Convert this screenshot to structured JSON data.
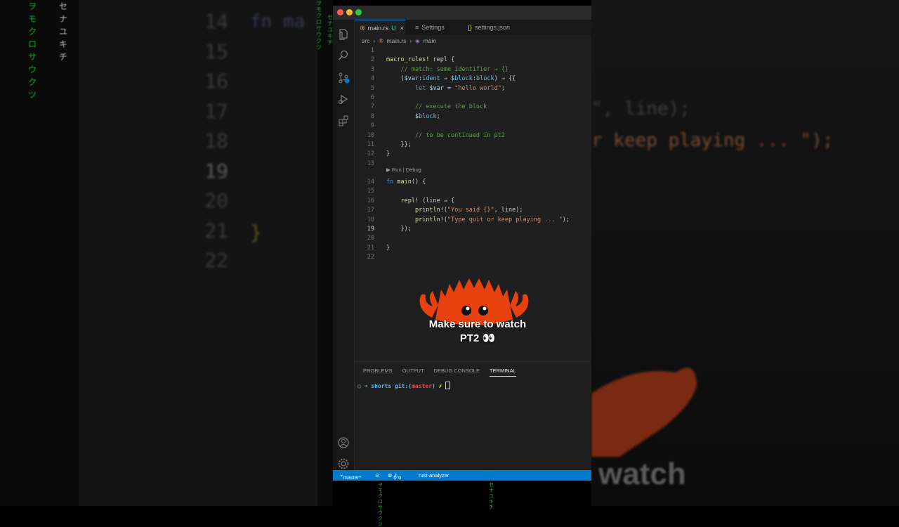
{
  "background": {
    "line_numbers": [
      "14",
      "15",
      "16",
      "17",
      "18",
      "19",
      "20",
      "21",
      "22"
    ],
    "code_fragment": "fn ma",
    "brace": "}",
    "right_line1": "\", line);",
    "right_line2a": "r keep playing ... \");",
    "right_watch": "watch",
    "matrix_chars": "ヲモクロサウクツ",
    "matrix_chars2": "セナユキチ"
  },
  "editor": {
    "tabs": [
      {
        "label": "main.rs",
        "badge": "U",
        "close": "×",
        "active": true
      },
      {
        "label": "Settings",
        "active": false
      },
      {
        "label": "settings.json",
        "active": false
      }
    ],
    "breadcrumb": [
      "src",
      "main.rs",
      "main"
    ],
    "codelens": "Run | Debug",
    "current_line": "19",
    "lines": [
      {
        "n": "1",
        "t": ""
      },
      {
        "n": "2",
        "t": "macro_rules! repl {"
      },
      {
        "n": "3",
        "t": "    // match: some_identifier ⇒ {}"
      },
      {
        "n": "4",
        "t": "    ($var:ident ⇒ $block:block) ⇒ {{"
      },
      {
        "n": "5",
        "t": "        let $var = \"hello world\";"
      },
      {
        "n": "6",
        "t": ""
      },
      {
        "n": "7",
        "t": "        // execute the block"
      },
      {
        "n": "8",
        "t": "        $block;"
      },
      {
        "n": "9",
        "t": ""
      },
      {
        "n": "10",
        "t": "        // to be continued in pt2"
      },
      {
        "n": "11",
        "t": "    }};"
      },
      {
        "n": "12",
        "t": "}"
      },
      {
        "n": "13",
        "t": ""
      },
      {
        "n": "14",
        "t": "fn main() {"
      },
      {
        "n": "15",
        "t": ""
      },
      {
        "n": "16",
        "t": "    repl! (line ⇒ {"
      },
      {
        "n": "17",
        "t": "        println!(\"You said {}\", line);"
      },
      {
        "n": "18",
        "t": "        println!(\"Type quit or keep playing ... \");"
      },
      {
        "n": "19",
        "t": "    });"
      },
      {
        "n": "20",
        "t": ""
      },
      {
        "n": "21",
        "t": "}"
      },
      {
        "n": "22",
        "t": ""
      }
    ]
  },
  "panel": {
    "tabs": [
      "PROBLEMS",
      "OUTPUT",
      "DEBUG CONSOLE",
      "TERMINAL"
    ],
    "active_tab": "TERMINAL",
    "terminal": {
      "prompt_arrow": "○ ➜",
      "dir": "shorts",
      "git": "git:(",
      "branch": "master",
      "git_close": ")",
      "dirty": "✗"
    }
  },
  "statusbar": {
    "branch": "master*",
    "errors": "0",
    "warnings": "0",
    "extension": "rust-analyzer"
  },
  "overlay": {
    "caption_line1": "Make sure to watch",
    "caption_line2": "PT2 👀"
  },
  "colors": {
    "accent": "#007acc",
    "crab": "#e8400f",
    "editor_bg": "#1f1f1f"
  }
}
